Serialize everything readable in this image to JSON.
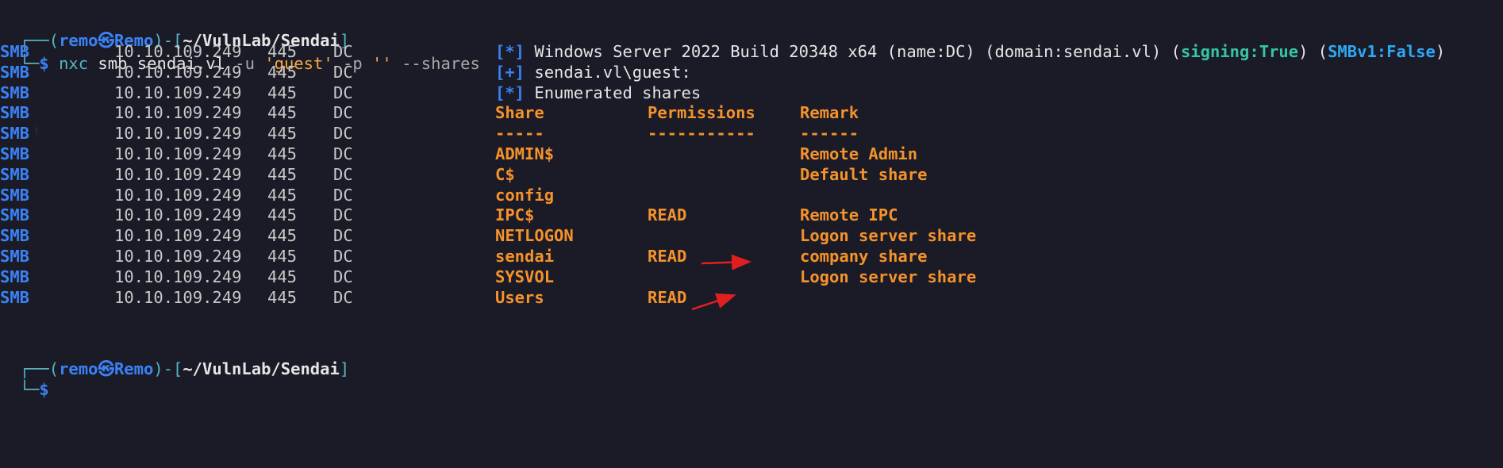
{
  "prompt": {
    "open": "┌──(",
    "user": "remo",
    "at": "㉿",
    "host": "Remo",
    "mid": ")-[",
    "path": "~/VulnLab/Sendai",
    "close": "]",
    "bottom": "└─",
    "dollar": "$"
  },
  "command": {
    "bin": "nxc",
    "args1": " smb sendai.vl ",
    "flag_u": "-u",
    "user_val": " 'guest' ",
    "flag_p": "-p",
    "pass_val": " '' ",
    "flag_shares": "--shares"
  },
  "output_prefix": {
    "proto": "SMB",
    "ip": "10.10.109.249",
    "port": "445",
    "host": "DC"
  },
  "info_lines": [
    {
      "tag": "[*]",
      "text_a": " Windows Server 2022 Build 20348 x64 (name:DC) (domain:sendai.vl) (",
      "signing": "signing:True",
      "text_b": ") (",
      "smbv1": "SMBv1:False",
      "text_c": ")"
    },
    {
      "tag": "[+]",
      "text": " sendai.vl\\guest:"
    },
    {
      "tag": "[*]",
      "text": " Enumerated shares"
    }
  ],
  "share_table": {
    "headers": [
      "Share",
      "Permissions",
      "Remark"
    ],
    "separators": [
      "-----",
      "-----------",
      "------"
    ],
    "rows": [
      {
        "share": "ADMIN$",
        "perm": "",
        "remark": "Remote Admin"
      },
      {
        "share": "C$",
        "perm": "",
        "remark": "Default share"
      },
      {
        "share": "config",
        "perm": "",
        "remark": ""
      },
      {
        "share": "IPC$",
        "perm": "READ",
        "remark": "Remote IPC"
      },
      {
        "share": "NETLOGON",
        "perm": "",
        "remark": "Logon server share"
      },
      {
        "share": "sendai",
        "perm": "READ",
        "remark": "company share"
      },
      {
        "share": "SYSVOL",
        "perm": "",
        "remark": "Logon server share"
      },
      {
        "share": "Users",
        "perm": "READ",
        "remark": ""
      }
    ]
  },
  "colors": {
    "background": "#1a1b26",
    "accent_blue": "#3b82f6",
    "orange": "#f5922b",
    "arrow_red": "#e02020"
  }
}
